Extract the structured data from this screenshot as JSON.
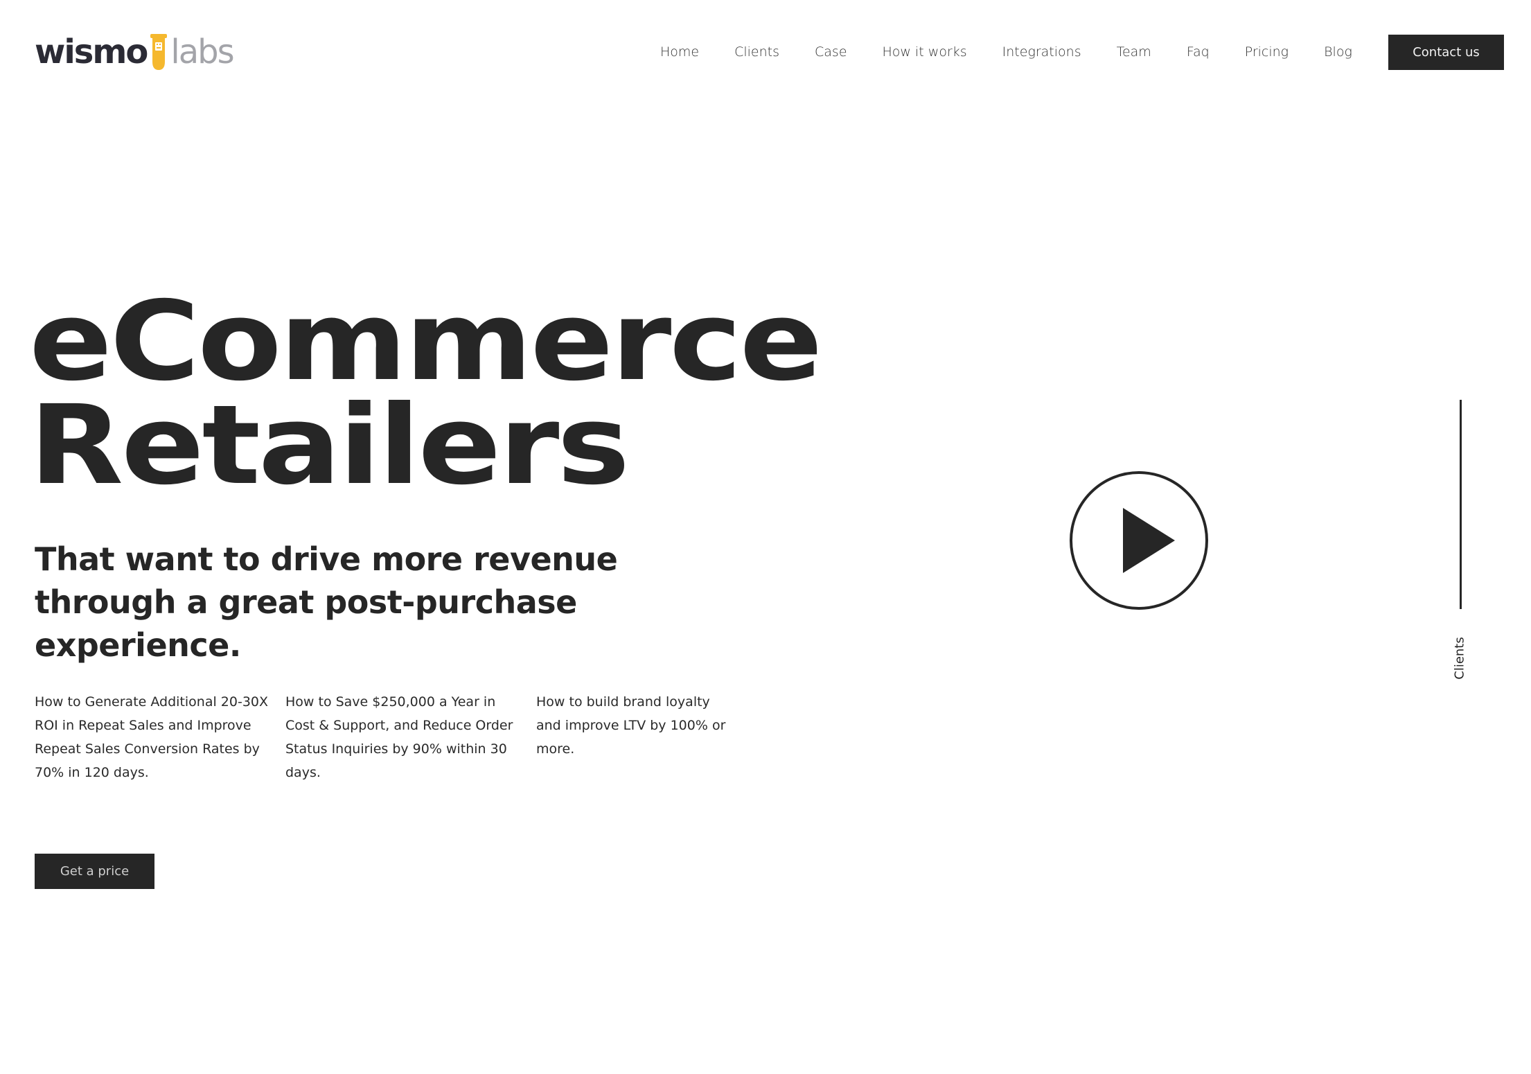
{
  "logo": {
    "part1": "wismo",
    "part2": "labs"
  },
  "nav": {
    "items": [
      "Home",
      "Clients",
      "Case",
      "How it works",
      "Integrations",
      "Team",
      "Faq",
      "Pricing",
      "Blog"
    ]
  },
  "header": {
    "contact_label": "Contact us"
  },
  "hero": {
    "title_line1": "eCommerce",
    "title_line2": "Retailers",
    "subtitle": "That want to drive more revenue through a great post-purchase experience.",
    "features": [
      "How to Generate Additional 20-30X ROI in Repeat Sales and Improve Repeat Sales Conversion Rates by 70% in 120 days.",
      "How to Save $250,000 a Year in Cost & Support, and Reduce Order Status Inquiries by 90% within 30 days.",
      "How to build brand loyalty and improve LTV by 100% or more."
    ],
    "cta_label": "Get a price"
  },
  "side": {
    "label": "Clients"
  },
  "colors": {
    "dark": "#262626",
    "accent": "#f5b82e",
    "logo_gray": "#a3a4a9"
  },
  "icons": {
    "play": "play-icon",
    "flask": "flask-icon"
  }
}
